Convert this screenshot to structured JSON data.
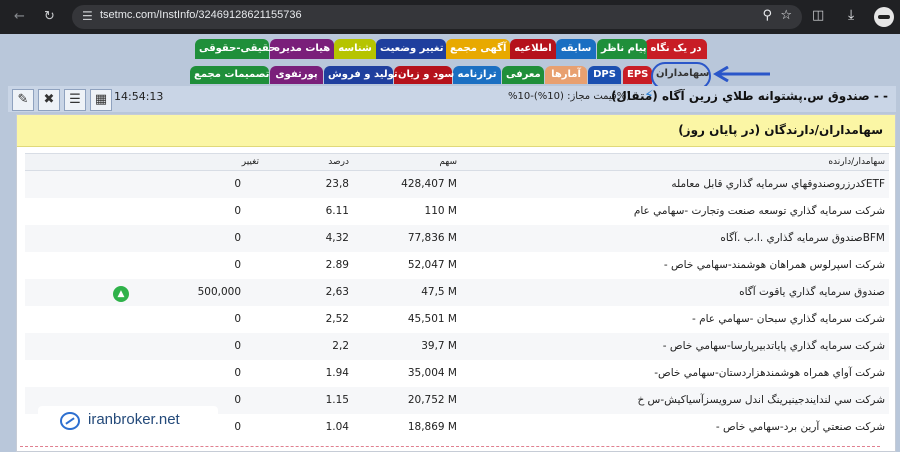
{
  "browser": {
    "url": "tsetmc.com/InstInfo/32469128621155736"
  },
  "tabs": [
    {
      "label": "در یک نگاه",
      "color": "#c81d25"
    },
    {
      "label": "پیام ناظر",
      "color": "#1f8f3a"
    },
    {
      "label": "سابقه",
      "color": "#1a6fc2"
    },
    {
      "label": "اطلاعیه",
      "color": "#b5121b"
    },
    {
      "label": "آگهی مجمع",
      "color": "#e8a900"
    },
    {
      "label": "تغییر وضعیت",
      "color": "#1f3f9e"
    },
    {
      "label": "شناسه",
      "color": "#b6c400"
    },
    {
      "label": "هیات مدیره",
      "color": "#7a1f7a"
    },
    {
      "label": "حقیقی-حقوقی",
      "color": "#1f8f3a"
    },
    {
      "label": "سهامداران",
      "color": "#b9c7da"
    },
    {
      "label": "EPS",
      "color": "#c81d25"
    },
    {
      "label": "DPS",
      "color": "#1a4fb0"
    },
    {
      "label": "آمارها",
      "color": "#e8a070"
    },
    {
      "label": "معرفی",
      "color": "#1f8f3a"
    },
    {
      "label": "ترازنامه",
      "color": "#1a6fc2"
    },
    {
      "label": "سود و زیان",
      "color": "#b5121b"
    },
    {
      "label": "تولید و فروش",
      "color": "#1f3f9e"
    },
    {
      "label": "پورتفوی",
      "color": "#7a1f7a"
    },
    {
      "label": "تصمیمات مجمع",
      "color": "#1f8f3a"
    }
  ],
  "info": {
    "fund_title": "صندوق س.پشتوانه طلاي زرين آگاه (متقال) - -",
    "price_info": "%قیمت مجاز: (10%)-10%)",
    "time": "14:54:13"
  },
  "panel": {
    "title": "سهامداران/دارندگان (در پایان روز)"
  },
  "table": {
    "headers": {
      "name": "سهامدار/دارنده",
      "shares": "سهم",
      "percent": "درصد",
      "change": "تغییر"
    },
    "rows": [
      {
        "name": "ETFكدرزروصندوقهاي سرمايه گذاري قابل معامله",
        "shares": "428,407 M",
        "percent": "23,8",
        "change": "0",
        "up": false
      },
      {
        "name": "شركت سرمايه گذاري توسعه صنعت وتجارت -سهامي عام",
        "shares": "110 M",
        "percent": "6.11",
        "change": "0",
        "up": false
      },
      {
        "name": "BFMصندوق سرمايه گذاري .ا.ب .آگاه",
        "shares": "77,836 M",
        "percent": "4,32",
        "change": "0",
        "up": false
      },
      {
        "name": "شركت اسپرلوس همراهان هوشمند-سهامي خاص -",
        "shares": "52,047 M",
        "percent": "2.89",
        "change": "0",
        "up": false
      },
      {
        "name": "صندوق سرمايه گذاري ياقوت آگاه",
        "shares": "47,5 M",
        "percent": "2,63",
        "change": "500,000",
        "up": true
      },
      {
        "name": "شركت سرمايه گذاري سبحان -سهامي عام -",
        "shares": "45,501 M",
        "percent": "2,52",
        "change": "0",
        "up": false
      },
      {
        "name": "شركت سرمايه گذاري پاياتدبيرپارسا-سهامي خاص -",
        "shares": "39,7 M",
        "percent": "2,2",
        "change": "0",
        "up": false
      },
      {
        "name": "شركت آواي همراه هوشمندهزاردستان-سهامي خاص-",
        "shares": "35,004 M",
        "percent": "1.94",
        "change": "0",
        "up": false
      },
      {
        "name": "شركت سي لندايندجينيرينگ اندل سرويسزآسياكيش-س خ",
        "shares": "20,752 M",
        "percent": "1.15",
        "change": "0",
        "up": false
      },
      {
        "name": "شركت صنعتي آرين برد-سهامي خاص -",
        "shares": "18,869 M",
        "percent": "1.04",
        "change": "0",
        "up": false
      }
    ]
  },
  "watermark": {
    "text": "iranbroker.net"
  }
}
